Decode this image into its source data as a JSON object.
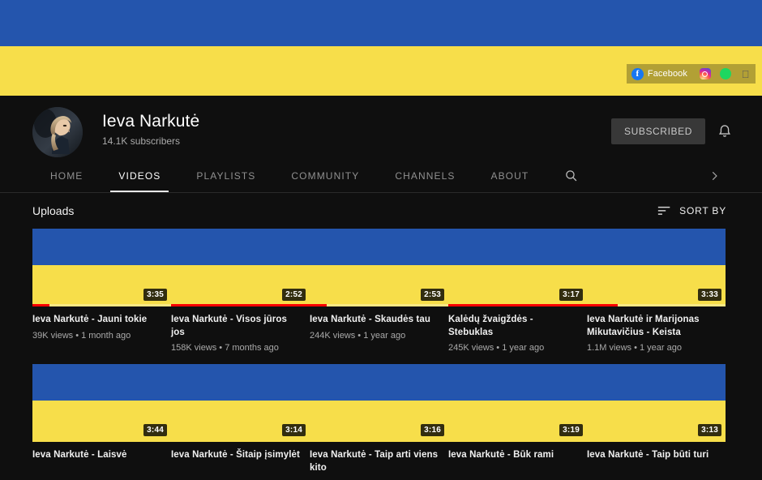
{
  "banner": {
    "colors": {
      "blue": "#2455ad",
      "yellow": "#f7de4a"
    },
    "social_links": [
      {
        "name": "Facebook",
        "label": "Facebook",
        "icon": "facebook-icon"
      },
      {
        "name": "Instagram",
        "label": "",
        "icon": "instagram-icon"
      },
      {
        "name": "Spotify",
        "label": "",
        "icon": "spotify-icon"
      },
      {
        "name": "Apple Music",
        "label": "",
        "icon": "apple-icon"
      }
    ]
  },
  "channel": {
    "name": "Ieva Narkutė",
    "subscribers": "14.1K subscribers",
    "subscribe_button": "SUBSCRIBED",
    "notification_icon": "bell-icon"
  },
  "tabs": [
    {
      "label": "HOME",
      "active": false
    },
    {
      "label": "VIDEOS",
      "active": true
    },
    {
      "label": "PLAYLISTS",
      "active": false
    },
    {
      "label": "COMMUNITY",
      "active": false
    },
    {
      "label": "CHANNELS",
      "active": false
    },
    {
      "label": "ABOUT",
      "active": false
    }
  ],
  "toolbar": {
    "search_icon": "search-icon",
    "overflow_icon": "chevron-right-icon",
    "uploads_title": "Uploads",
    "sort_by_label": "SORT BY",
    "sort_icon": "sort-icon"
  },
  "videos": [
    {
      "title": "Ieva Narkutė - Jauni tokie",
      "views": "39K views",
      "age": "1 month ago",
      "stats": "39K views • 1 month ago",
      "duration": "3:35",
      "progress": 12
    },
    {
      "title": "Ieva Narkutė - Visos jūros jos",
      "views": "158K views",
      "age": "7 months ago",
      "stats": "158K views • 7 months ago",
      "duration": "2:52",
      "progress": 100
    },
    {
      "title": "Ieva Narkutė - Skaudės tau",
      "views": "244K views",
      "age": "1 year ago",
      "stats": "244K views • 1 year ago",
      "duration": "2:53",
      "progress": 12
    },
    {
      "title": "Kalėdų žvaigždės - Stebuklas",
      "views": "245K views",
      "age": "1 year ago",
      "stats": "245K views • 1 year ago",
      "duration": "3:17",
      "progress": 100
    },
    {
      "title": "Ieva Narkutė ir Marijonas Mikutavičius - Keista",
      "views": "1.1M views",
      "age": "1 year ago",
      "stats": "1.1M views • 1 year ago",
      "duration": "3:33",
      "progress": 22
    },
    {
      "title": "Ieva Narkutė - Laisvė",
      "views": "",
      "age": "",
      "stats": "",
      "duration": "3:44",
      "progress": 0
    },
    {
      "title": "Ieva Narkutė - Šitaip įsimylėt",
      "views": "",
      "age": "",
      "stats": "",
      "duration": "3:14",
      "progress": 0
    },
    {
      "title": "Ieva Narkutė - Taip arti viens kito",
      "views": "",
      "age": "",
      "stats": "",
      "duration": "3:16",
      "progress": 0
    },
    {
      "title": "Ieva Narkutė - Būk rami",
      "views": "",
      "age": "",
      "stats": "",
      "duration": "3:19",
      "progress": 0
    },
    {
      "title": "Ieva Narkutė - Taip būti turi",
      "views": "",
      "age": "",
      "stats": "",
      "duration": "3:13",
      "progress": 0
    }
  ]
}
